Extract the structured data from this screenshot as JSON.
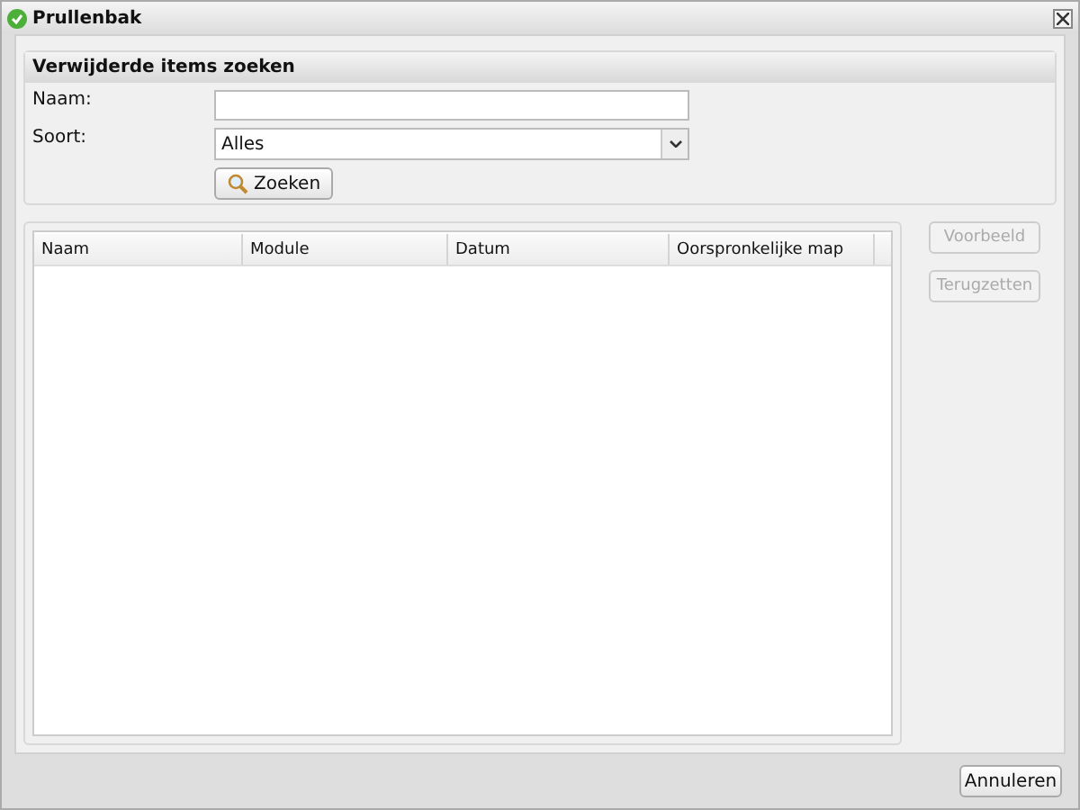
{
  "window": {
    "title": "Prullenbak"
  },
  "search": {
    "title": "Verwijderde items zoeken",
    "name_label": "Naam:",
    "type_label": "Soort:",
    "type_value": "Alles",
    "button": "Zoeken"
  },
  "table": {
    "columns": [
      "Naam",
      "Module",
      "Datum",
      "Oorspronkelijke map"
    ]
  },
  "side_buttons": [
    {
      "label": "Voorbeeld",
      "disabled": true
    },
    {
      "label": "Terugzetten",
      "disabled": true
    }
  ],
  "footer_buttons": [
    "Annuleren"
  ]
}
